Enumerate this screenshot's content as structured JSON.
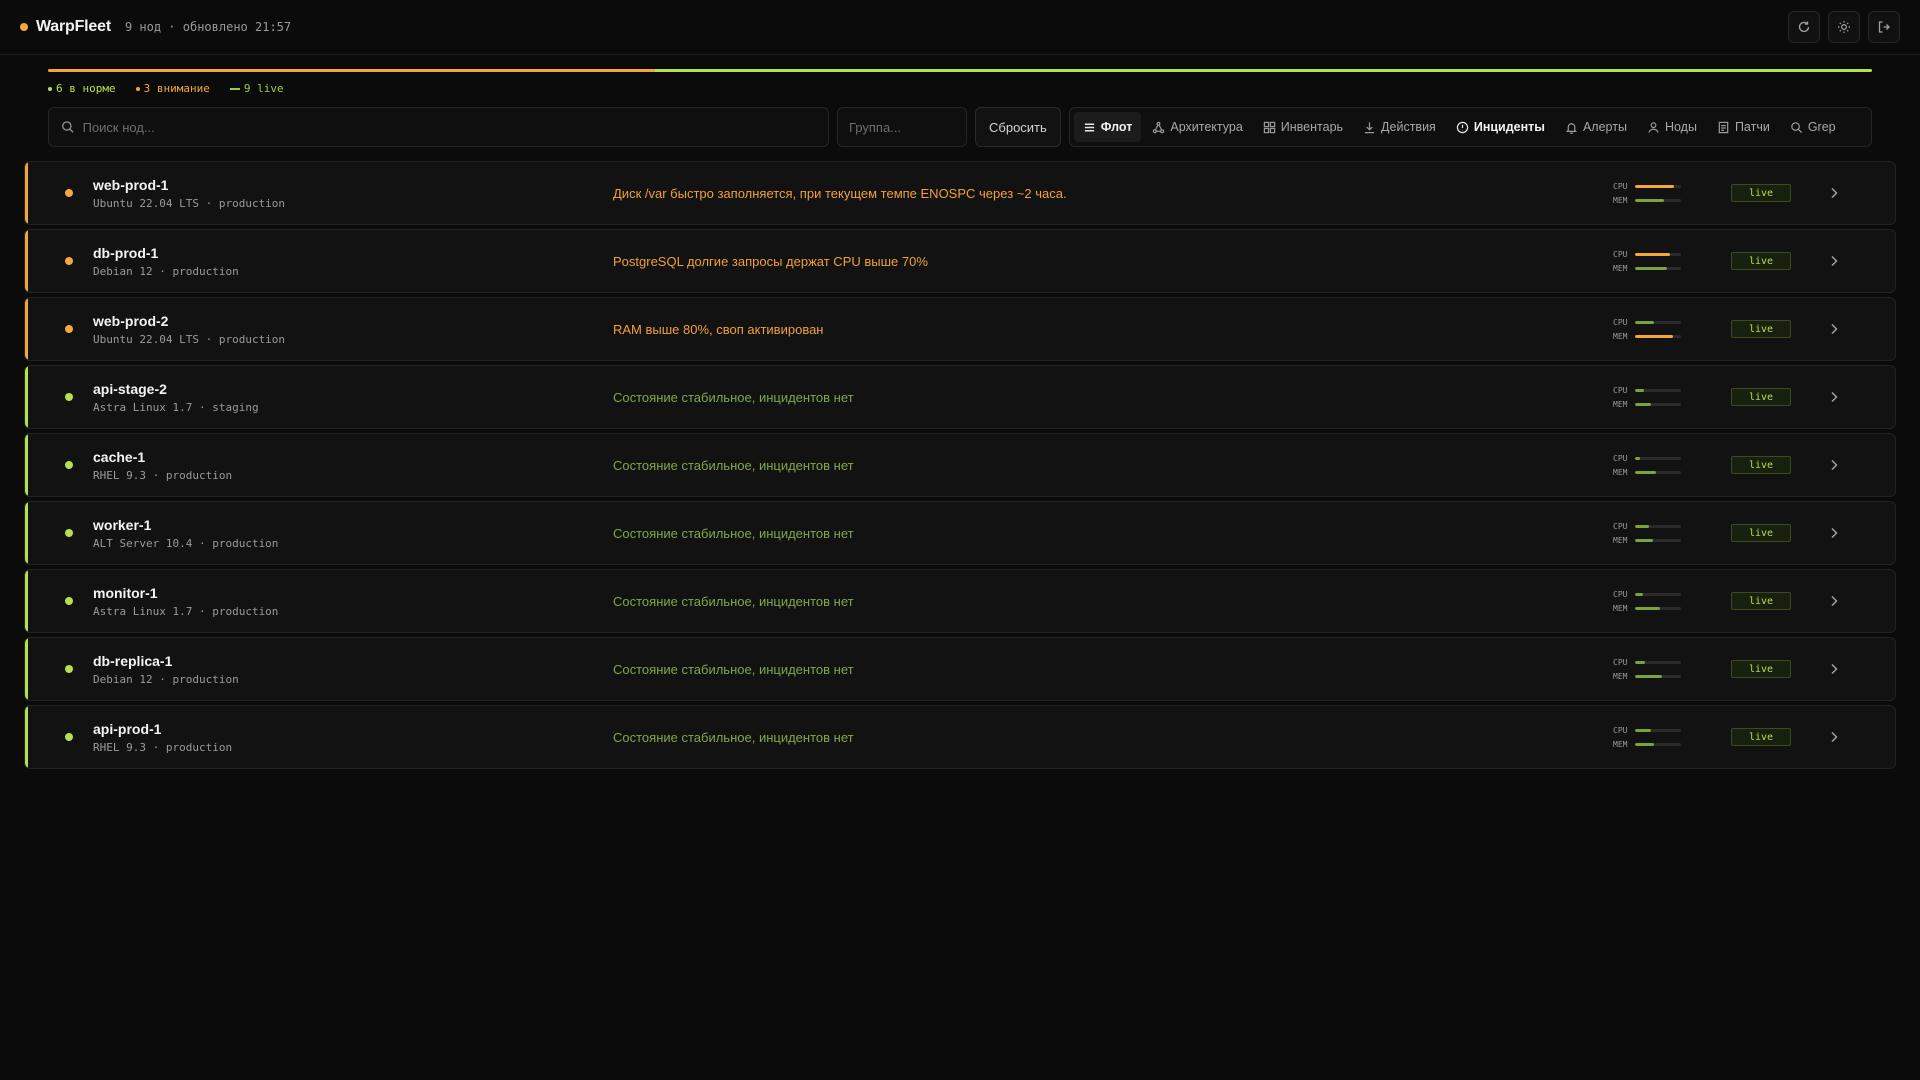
{
  "app": {
    "name": "WarpFleet",
    "meta": "9 нод · обновлено 21:57",
    "brand_color": "#f5a73b"
  },
  "header_actions": [
    {
      "name": "refresh-icon"
    },
    {
      "name": "theme-icon"
    },
    {
      "name": "logout-icon"
    }
  ],
  "fleet_progress": {
    "warning_fraction": 0.333,
    "ok_fraction": 0.667,
    "warning_color": "#f5a73b",
    "ok_color": "#b6e04c"
  },
  "legend": {
    "ok": "6 в норме",
    "warn": "3 внимание",
    "live": "9 live"
  },
  "toolbar": {
    "search_placeholder": "Поиск нод...",
    "group_placeholder": "Группа...",
    "reset_label": "Сбросить"
  },
  "tabs": [
    {
      "label": "Флот",
      "icon": "list-icon",
      "state": "active"
    },
    {
      "label": "Архитектура",
      "icon": "architecture-icon",
      "state": ""
    },
    {
      "label": "Инвентарь",
      "icon": "grid-icon",
      "state": ""
    },
    {
      "label": "Действия",
      "icon": "download-icon",
      "state": ""
    },
    {
      "label": "Инциденты",
      "icon": "alert-circle-icon",
      "state": "bold"
    },
    {
      "label": "Алерты",
      "icon": "bell-icon",
      "state": ""
    },
    {
      "label": "Ноды",
      "icon": "user-icon",
      "state": ""
    },
    {
      "label": "Патчи",
      "icon": "document-icon",
      "state": ""
    },
    {
      "label": "Grep",
      "icon": "search-icon",
      "state": ""
    }
  ],
  "colors": {
    "warn": "#f5a73b",
    "ok": "#b6e04c",
    "msg_warn": "#f0a03a",
    "msg_ok": "#7fa84a"
  },
  "nodes": [
    {
      "name": "web-prod-1",
      "sub": "Ubuntu 22.04 LTS · production",
      "status": "warn",
      "message": "Диск /var быстро заполняется, при текущем темпе ENOSPC через ~2 часа.",
      "cpu": 0.85,
      "mem": 0.62,
      "cpu_level": "warn",
      "mem_level": "ok",
      "badge": "live"
    },
    {
      "name": "db-prod-1",
      "sub": "Debian 12 · production",
      "status": "warn",
      "message": "PostgreSQL долгие запросы держат CPU выше 70%",
      "cpu": 0.76,
      "mem": 0.7,
      "cpu_level": "warn",
      "mem_level": "ok",
      "badge": "live"
    },
    {
      "name": "web-prod-2",
      "sub": "Ubuntu 22.04 LTS · production",
      "status": "warn",
      "message": "RAM выше 80%, своп активирован",
      "cpu": 0.42,
      "mem": 0.82,
      "cpu_level": "ok",
      "mem_level": "warn",
      "badge": "live"
    },
    {
      "name": "api-stage-2",
      "sub": "Astra Linux 1.7 · staging",
      "status": "ok",
      "message": "Состояние стабильное, инцидентов нет",
      "cpu": 0.2,
      "mem": 0.35,
      "cpu_level": "ok",
      "mem_level": "ok",
      "badge": "live"
    },
    {
      "name": "cache-1",
      "sub": "RHEL 9.3 · production",
      "status": "ok",
      "message": "Состояние стабильное, инцидентов нет",
      "cpu": 0.1,
      "mem": 0.45,
      "cpu_level": "ok",
      "mem_level": "ok",
      "badge": "live"
    },
    {
      "name": "worker-1",
      "sub": "ALT Server 10.4 · production",
      "status": "ok",
      "message": "Состояние стабильное, инцидентов нет",
      "cpu": 0.3,
      "mem": 0.4,
      "cpu_level": "ok",
      "mem_level": "ok",
      "badge": "live"
    },
    {
      "name": "monitor-1",
      "sub": "Astra Linux 1.7 · production",
      "status": "ok",
      "message": "Состояние стабильное, инцидентов нет",
      "cpu": 0.18,
      "mem": 0.55,
      "cpu_level": "ok",
      "mem_level": "ok",
      "badge": "live"
    },
    {
      "name": "db-replica-1",
      "sub": "Debian 12 · production",
      "status": "ok",
      "message": "Состояние стабильное, инцидентов нет",
      "cpu": 0.22,
      "mem": 0.58,
      "cpu_level": "ok",
      "mem_level": "ok",
      "badge": "live"
    },
    {
      "name": "api-prod-1",
      "sub": "RHEL 9.3 · production",
      "status": "ok",
      "message": "Состояние стабильное, инцидентов нет",
      "cpu": 0.35,
      "mem": 0.42,
      "cpu_level": "ok",
      "mem_level": "ok",
      "badge": "live"
    }
  ]
}
